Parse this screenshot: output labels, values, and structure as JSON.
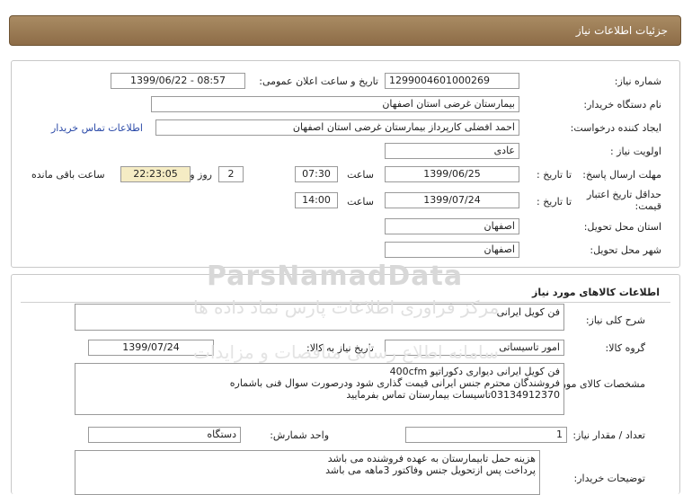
{
  "header": {
    "title": "جزئیات اطلاعات نیاز"
  },
  "info": {
    "need_number_label": "شماره نیاز:",
    "need_number": "1299004601000269",
    "announce_label": "تاریخ و ساعت اعلان عمومی:",
    "announce_value": "1399/06/22 - 08:57",
    "buyer_org_label": "نام دستگاه خریدار:",
    "buyer_org": "بیمارستان غرضی استان اصفهان",
    "requester_label": "ایجاد کننده درخواست:",
    "requester": "احمد افضلی کارپرداز بیمارستان غرضی استان اصفهان",
    "contact_link": "اطلاعات تماس خریدار",
    "priority_label": "اولویت نیاز :",
    "priority": "عادی",
    "deadline_label": "مهلت ارسال پاسخ:",
    "to_date_label": "تا تاریخ :",
    "deadline_date": "1399/06/25",
    "time_label": "ساعت",
    "deadline_time": "07:30",
    "days_value": "2",
    "days_label": "روز و",
    "remaining_time": "22:23:05",
    "remaining_label": "ساعت باقی مانده",
    "validity_label": "حداقل تاریخ اعتبار قیمت:",
    "validity_date": "1399/07/24",
    "validity_time": "14:00",
    "province_label": "استان محل تحویل:",
    "province": "اصفهان",
    "city_label": "شهر محل تحویل:",
    "city": "اصفهان"
  },
  "goods": {
    "section_title": "اطلاعات کالاهای مورد نیاز",
    "summary_label": "شرح کلی نیاز:",
    "summary": "فن کویل ایرانی",
    "group_label": "گروه کالا:",
    "group": "امور تاسیساتی",
    "need_date_label": "تاریخ نیاز به کالا:",
    "need_date": "1399/07/24",
    "specs_label": "مشخصات کالای مورد نیاز:",
    "specs_lines": [
      "فن کویل ایرانی دیواری دکوراتیو 400cfm",
      "فروشندگان محترم جنس ایرانی قیمت گذاری شود ودرصورت سوال فنی باشماره",
      "03134912370تاسیسات بیمارستان تماس بفرمایید"
    ],
    "qty_label": "تعداد / مقدار نیاز:",
    "qty": "1",
    "unit_label": "واحد شمارش:",
    "unit": "دستگاه",
    "notes_label": "توضیحات خریدار:",
    "notes_lines": [
      "هزینه حمل تابیمارستان به عهده فروشنده می باشد",
      "پرداخت پس ازتحویل جنس وفاکتور 3ماهه می باشد"
    ]
  },
  "watermark": {
    "brand": "ParsNamadData",
    "line1": "مرکز فراوری اطلاعات پارس نماد داده ها",
    "line2": "سامانه اطلاع رسانی مناقصات و مزایدات"
  }
}
